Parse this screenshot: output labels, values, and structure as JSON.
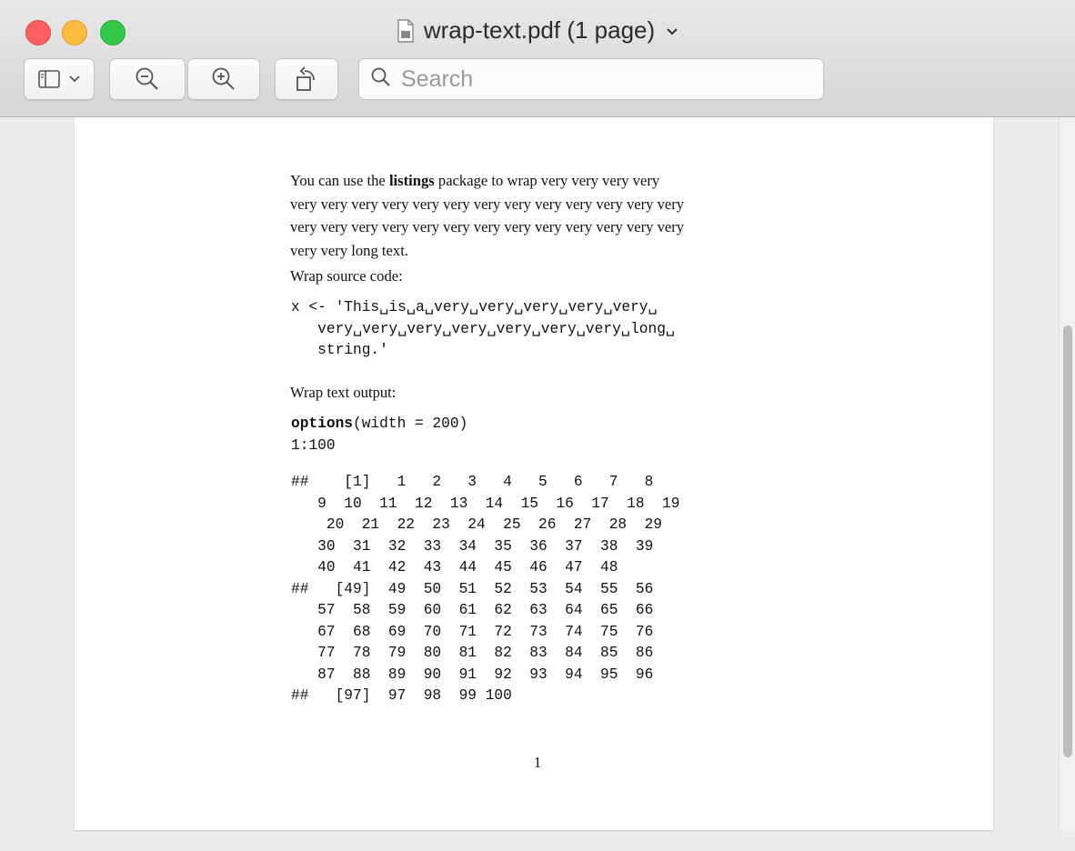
{
  "window": {
    "title": "wrap-text.pdf (1 page)",
    "title_chevron": "⌄"
  },
  "toolbar": {
    "search_placeholder": "Search",
    "buttons": [
      "sidebar-toggle",
      "zoom-out",
      "zoom-in",
      "rotate-left"
    ]
  },
  "document": {
    "intro": {
      "before": "You can use the ",
      "bold": "listings",
      "after": " package to wrap very very very very very very very very very very very very very very very very very very very very very very very very very very very very very very very very very very very very very very very long text."
    },
    "intro_lines": [
      "package to wrap very very very very",
      "very very very very very very very very very very very very very",
      "very very very very very very very very very very very very very",
      "very very long text."
    ],
    "wrap_source_label": "Wrap source code:",
    "source_code_lines": [
      "x <- 'This␣is␣a␣very␣very␣very␣very␣very␣",
      "   very␣very␣very␣very␣very␣very␣very␣long␣",
      "   string.'"
    ],
    "source_code_token": "x",
    "source_code_arrow": "<-",
    "wrap_output_label": "Wrap text output:",
    "output_code_bold": "options",
    "output_code_line1_rest": "(width = 200)",
    "output_code_line2": "1:100",
    "result_lines": [
      "##    [1]   1   2   3   4   5   6   7   8",
      "   9  10  11  12  13  14  15  16  17  18  19",
      "    20  21  22  23  24  25  26  27  28  29",
      "   30  31  32  33  34  35  36  37  38  39",
      "   40  41  42  43  44  45  46  47  48",
      "##   [49]  49  50  51  52  53  54  55  56",
      "   57  58  59  60  61  62  63  64  65  66",
      "   67  68  69  70  71  72  73  74  75  76",
      "   77  78  79  80  81  82  83  84  85  86",
      "   87  88  89  90  91  92  93  94  95  96",
      "##   [97]  97  98  99 100"
    ],
    "page_number": "1"
  },
  "colors": {
    "close": "#fc605c",
    "minimize": "#fdbc40",
    "maximize": "#34c84a"
  }
}
